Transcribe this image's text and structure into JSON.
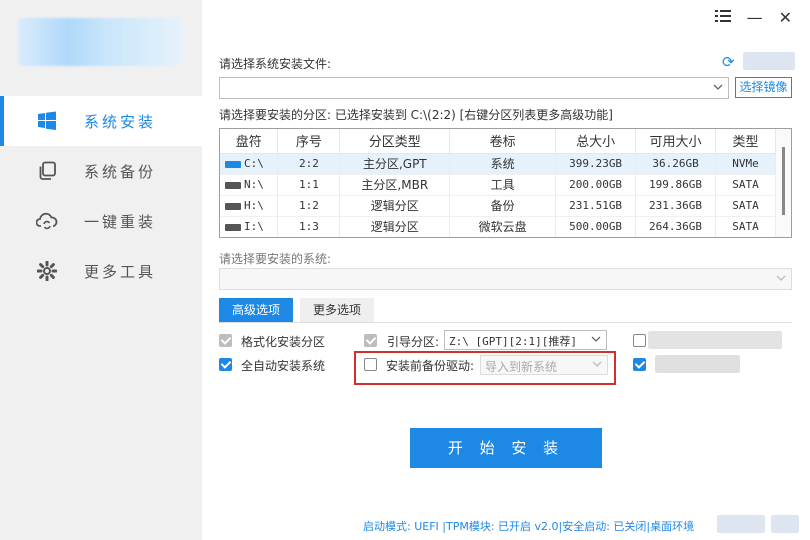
{
  "window": {
    "menu_icon": "hamburger-icon",
    "minimize_glyph": "—",
    "close_glyph": "✕"
  },
  "sidebar": {
    "items": [
      {
        "label": "系统安装",
        "icon": "windows-icon",
        "active": true
      },
      {
        "label": "系统备份",
        "icon": "copy-icon",
        "active": false
      },
      {
        "label": "一键重装",
        "icon": "cloud-sync-icon",
        "active": false
      },
      {
        "label": "更多工具",
        "icon": "gear-icon",
        "active": false
      }
    ]
  },
  "install_file": {
    "label": "请选择系统安装文件:",
    "value": "",
    "browse_label": "选择镜像"
  },
  "partition": {
    "label": "请选择要安装的分区: 已选择安装到 C:\\(2:2) [右键分区列表更多高级功能]",
    "columns": [
      "盘符",
      "序号",
      "分区类型",
      "卷标",
      "总大小",
      "可用大小",
      "类型"
    ],
    "rows": [
      {
        "drive": "C:\\",
        "index": "2:2",
        "ptype": "主分区,GPT",
        "volume": "系统",
        "total": "399.23GB",
        "free": "36.26GB",
        "type": "NVMe",
        "selected": true,
        "color": "#1e88e5"
      },
      {
        "drive": "N:\\",
        "index": "1:1",
        "ptype": "主分区,MBR",
        "volume": "工具",
        "total": "200.00GB",
        "free": "199.86GB",
        "type": "SATA",
        "selected": false,
        "color": "#555555"
      },
      {
        "drive": "H:\\",
        "index": "1:2",
        "ptype": "逻辑分区",
        "volume": "备份",
        "total": "231.51GB",
        "free": "231.36GB",
        "type": "SATA",
        "selected": false,
        "color": "#555555"
      },
      {
        "drive": "I:\\",
        "index": "1:3",
        "ptype": "逻辑分区",
        "volume": "微软云盘",
        "total": "500.00GB",
        "free": "264.36GB",
        "type": "SATA",
        "selected": false,
        "color": "#555555"
      }
    ]
  },
  "system_select": {
    "label": "请选择要安装的系统:",
    "value": ""
  },
  "tabs": {
    "advanced": "高级选项",
    "more": "更多选项"
  },
  "options": {
    "format_partition": {
      "label": "格式化安装分区",
      "checked": true,
      "disabled": true
    },
    "boot_partition": {
      "label": "引导分区:",
      "value": "Z:\\ [GPT][2:1][推荐]",
      "checked": true,
      "disabled": true
    },
    "auto_install": {
      "label": "全自动安装系统",
      "checked": true
    },
    "backup_drivers": {
      "label": "安装前备份驱动:",
      "checked": false,
      "select_value": "导入到新系统"
    }
  },
  "start_button": "开 始 安 装",
  "status_bar": "启动模式: UEFI |TPM模块: 已开启 v2.0|安全启动: 已关闭|桌面环境",
  "colors": {
    "accent": "#1e88e5",
    "highlight_border": "#d32f2f",
    "sidebar_bg": "#f0f0f0"
  }
}
